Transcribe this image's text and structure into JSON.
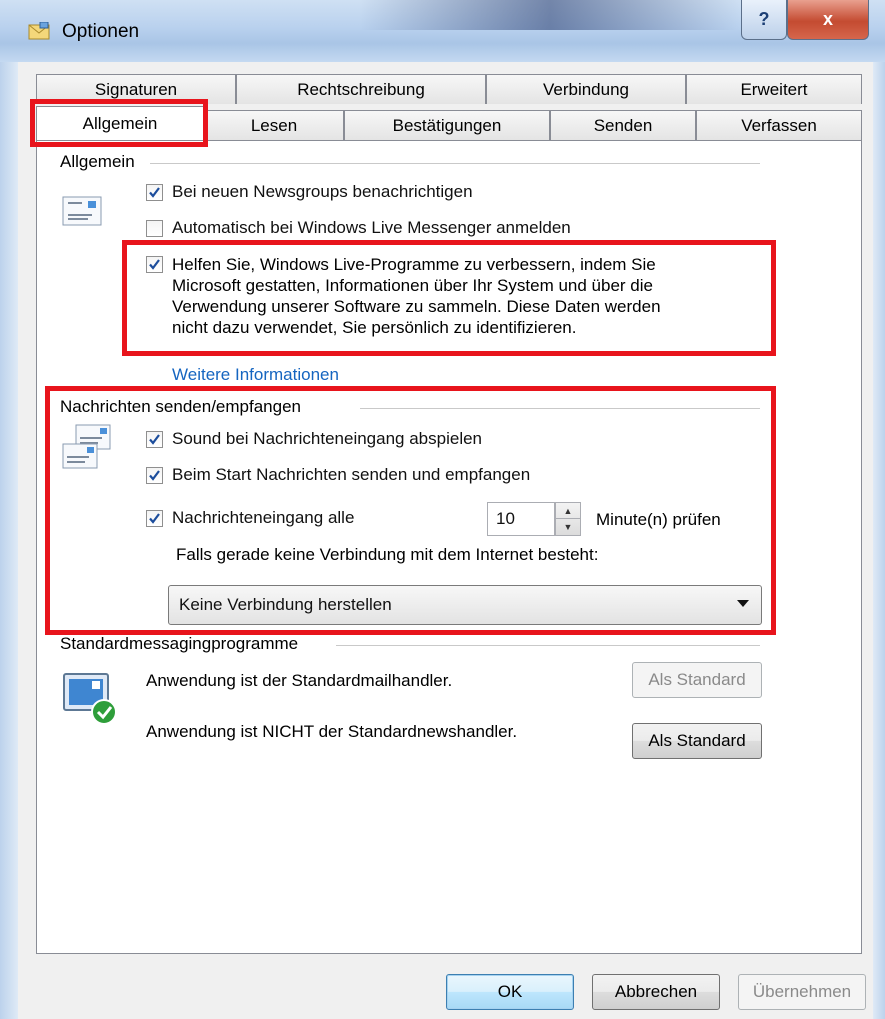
{
  "window": {
    "title": "Optionen",
    "help_label": "?",
    "close_label": "x"
  },
  "tabs_row1": [
    {
      "label": "Signaturen"
    },
    {
      "label": "Rechtschreibung"
    },
    {
      "label": "Verbindung"
    },
    {
      "label": "Erweitert"
    }
  ],
  "tabs_row2": [
    {
      "label": "Allgemein",
      "active": true
    },
    {
      "label": "Lesen"
    },
    {
      "label": "Bestätigungen"
    },
    {
      "label": "Senden"
    },
    {
      "label": "Verfassen"
    }
  ],
  "general": {
    "title": "Allgemein",
    "notify_newsgroups": {
      "label": "Bei neuen Newsgroups benachrichtigen",
      "checked": true
    },
    "auto_login_messenger": {
      "label": "Automatisch bei Windows Live Messenger anmelden",
      "checked": false
    },
    "improve_programs": {
      "lines": [
        "Helfen Sie, Windows Live-Programme zu verbessern, indem Sie",
        "Microsoft gestatten, Informationen über Ihr System und über die",
        "Verwendung unserer Software zu sammeln. Diese Daten werden",
        "nicht dazu verwendet, Sie persönlich zu identifizieren."
      ],
      "checked": true
    },
    "more_info_link": "Weitere Informationen"
  },
  "send_receive": {
    "title": "Nachrichten senden/empfangen",
    "play_sound": {
      "label": "Sound bei Nachrichteneingang abspielen",
      "checked": true
    },
    "send_receive_on_start": {
      "label": "Beim Start Nachrichten senden und empfangen",
      "checked": true
    },
    "check_every": {
      "label": "Nachrichteneingang alle",
      "checked": true,
      "value": "10",
      "unit_label": "Minute(n) prüfen"
    },
    "offline_label": "Falls gerade keine Verbindung mit dem Internet besteht:",
    "offline_select": "Keine Verbindung herstellen"
  },
  "default_programs": {
    "title": "Standardmessagingprogramme",
    "mail_text": "Anwendung ist der Standardmailhandler.",
    "news_text": "Anwendung ist NICHT der Standardnewshandler.",
    "mail_button": "Als Standard",
    "news_button": "Als Standard"
  },
  "footer": {
    "ok": "OK",
    "cancel": "Abbrechen",
    "apply": "Übernehmen"
  },
  "colors": {
    "highlight": "#e8141c",
    "link": "#1565c0",
    "check": "#1c4d9c"
  }
}
